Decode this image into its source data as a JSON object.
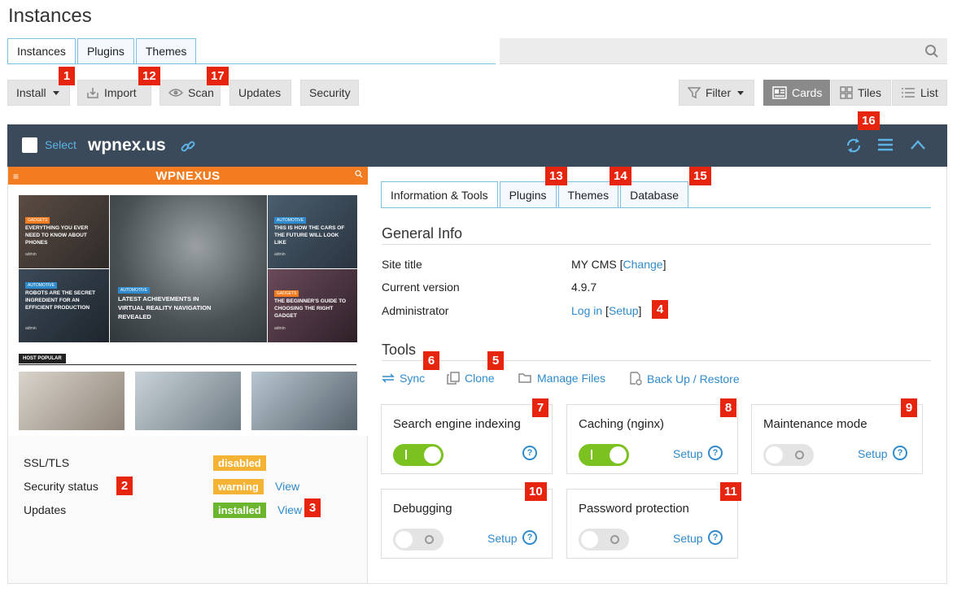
{
  "page": {
    "title": "Instances"
  },
  "top_tabs": [
    {
      "label": "Instances",
      "active": true
    },
    {
      "label": "Plugins",
      "active": false
    },
    {
      "label": "Themes",
      "active": false
    }
  ],
  "search": {
    "placeholder": "",
    "icon": "search-icon"
  },
  "toolbar": {
    "install": "Install",
    "import": "Import",
    "scan": "Scan",
    "updates": "Updates",
    "security": "Security",
    "filter": "Filter",
    "cards": "Cards",
    "tiles": "Tiles",
    "list": "List",
    "active_view": "Cards"
  },
  "badges": {
    "b1": "1",
    "b2": "2",
    "b3": "3",
    "b4": "4",
    "b5": "5",
    "b6": "6",
    "b7": "7",
    "b8": "8",
    "b9": "9",
    "b10": "10",
    "b11": "11",
    "b12": "12",
    "b13": "13",
    "b14": "14",
    "b15": "15",
    "b16": "16",
    "b17": "17"
  },
  "site": {
    "select_label": "Select",
    "name": "wpnex.us"
  },
  "screenshot": {
    "logo": "WPNEXUS",
    "menu_icon": "≡",
    "tiles": [
      {
        "tag": "GADGETS",
        "title": "EVERYTHING YOU EVER NEED TO KNOW ABOUT PHONES",
        "author": "admin"
      },
      {
        "tag": "AUTOMOTIVE",
        "title": "LATEST ACHIEVEMENTS IN VIRTUAL REALITY NAVIGATION REVEALED",
        "author": ""
      },
      {
        "tag": "AUTOMOTIVE",
        "title": "THIS IS HOW THE CARS OF THE FUTURE WILL LOOK LIKE",
        "author": "admin"
      },
      {
        "tag": "AUTOMOTIVE",
        "title": "ROBOTS ARE THE SECRET INGREDIENT FOR AN EFFICIENT PRODUCTION",
        "author": "admin"
      },
      {
        "tag": "GADGETS",
        "title": "THE BEGINNER'S GUIDE TO CHOOSING THE RIGHT GADGET",
        "author": "admin"
      }
    ],
    "section_label": "HOST POPULAR"
  },
  "status": {
    "ssl_label": "SSL/TLS",
    "ssl_value": "disabled",
    "security_label": "Security status",
    "security_value": "warning",
    "security_view": "View",
    "updates_label": "Updates",
    "updates_value": "installed",
    "updates_view": "View",
    "colors": {
      "disabled": "#f5b335",
      "warning": "#f5b335",
      "installed": "#6cb52f"
    }
  },
  "sub_tabs": [
    {
      "label": "Information & Tools",
      "active": true
    },
    {
      "label": "Plugins",
      "active": false
    },
    {
      "label": "Themes",
      "active": false
    },
    {
      "label": "Database",
      "active": false
    }
  ],
  "general_info": {
    "title": "General Info",
    "site_title_label": "Site title",
    "site_title_value": "MY CMS",
    "change_link": "Change",
    "version_label": "Current version",
    "version_value": "4.9.7",
    "admin_label": "Administrator",
    "login_link": "Log in",
    "setup_link": "Setup"
  },
  "tools": {
    "title": "Tools",
    "sync": "Sync",
    "clone": "Clone",
    "manage_files": "Manage Files",
    "backup": "Back Up / Restore"
  },
  "cards": [
    {
      "title": "Search engine indexing",
      "on": true,
      "setup": ""
    },
    {
      "title": "Caching (nginx)",
      "on": true,
      "setup": "Setup"
    },
    {
      "title": "Maintenance mode",
      "on": false,
      "setup": "Setup"
    },
    {
      "title": "Debugging",
      "on": false,
      "setup": "Setup"
    },
    {
      "title": "Password protection",
      "on": false,
      "setup": "Setup"
    }
  ],
  "accent_color": "#2f8bcb",
  "badge_color": "#e7250e"
}
